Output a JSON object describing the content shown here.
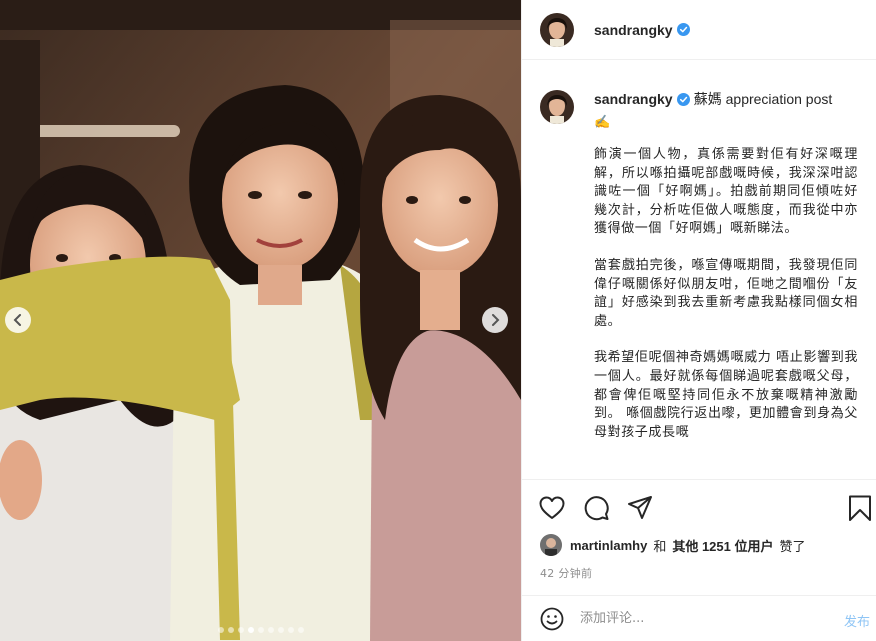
{
  "post": {
    "username": "sandrangky",
    "verified": true,
    "caption_title": "蘇媽 appreciation post",
    "caption_emoji": "✍️",
    "paragraphs": [
      "飾演一個人物，真係需要對佢有好深嘅理解，所以喺拍攝呢部戲嘅時候，我深深咁認識咗一個「好啊媽」。拍戲前期同佢傾咗好幾次計，分析咗佢做人嘅態度，而我從中亦獲得做一個「好啊媽」嘅新睇法。",
      "當套戲拍完後，喺宣傳嘅期間，我發現佢同偉仔嘅關係好似朋友咁，佢哋之間嗰份「友誼」好感染到我去重新考慮我點樣同個女相處。",
      "我希望佢呢個神奇媽媽嘅威力 唔止影響到我一個人。最好就係每個睇過呢套戲嘅父母，都會俾佢嘅堅持同佢永不放棄嘅精神激勵到。 喺個戲院行返出嚟，更加體會到身為父母對孩子成長嘅"
    ]
  },
  "likes": {
    "liker": "martinlamhy",
    "connector": "和",
    "others": "其他 1251 位用户",
    "suffix": "赞了"
  },
  "timestamp": "42 分钟前",
  "comment": {
    "placeholder": "添加评论...",
    "post_label": "发布"
  },
  "icons": {
    "like": "heart-icon",
    "comment": "comment-bubble-icon",
    "share": "paper-plane-icon",
    "save": "bookmark-icon",
    "emoji": "smiley-icon",
    "verified": "verified-badge-icon",
    "prev": "chevron-left-icon",
    "next": "chevron-right-icon"
  },
  "carousel": {
    "total_slides": 9,
    "active_slide": 3
  },
  "colors": {
    "verified_blue": "#3897f0",
    "link_disabled_blue": "#8fc5f5",
    "muted_text": "#8e8e8e"
  }
}
